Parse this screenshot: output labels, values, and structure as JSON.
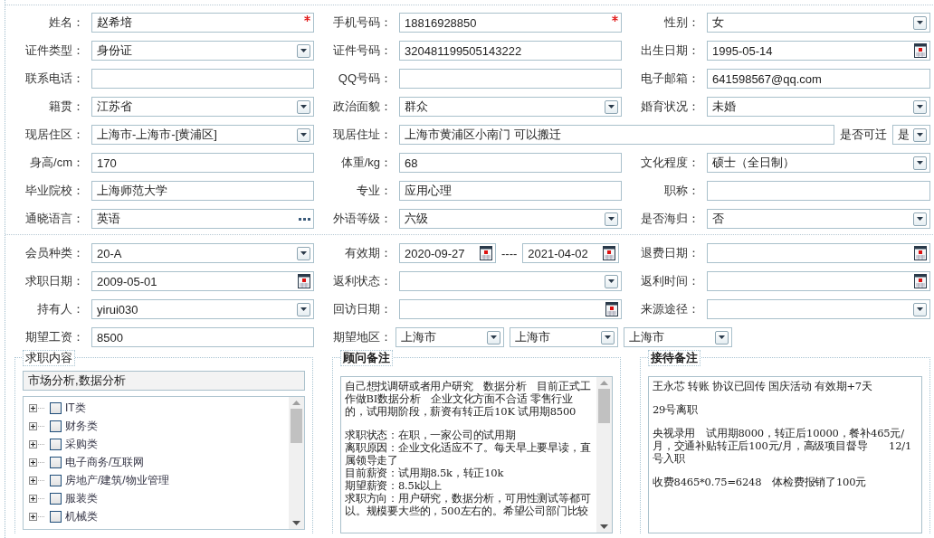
{
  "personal": {
    "rows": [
      {
        "fields": [
          {
            "label": "姓名：",
            "kind": "text",
            "value": "赵希培",
            "required": true
          },
          {
            "label": "手机号码：",
            "kind": "text",
            "value": "18816928850",
            "required": true
          },
          {
            "label": "性别：",
            "kind": "select",
            "value": "女"
          }
        ]
      },
      {
        "fields": [
          {
            "label": "证件类型：",
            "kind": "select",
            "value": "身份证"
          },
          {
            "label": "证件号码：",
            "kind": "text",
            "value": "320481199505143222"
          },
          {
            "label": "出生日期：",
            "kind": "date",
            "value": "1995-05-14"
          }
        ]
      },
      {
        "fields": [
          {
            "label": "联系电话：",
            "kind": "text"
          },
          {
            "label": "QQ号码：",
            "kind": "text"
          },
          {
            "label": "电子邮箱：",
            "kind": "text",
            "value": "641598567@qq.com"
          }
        ]
      },
      {
        "fields": [
          {
            "label": "籍贯：",
            "kind": "select",
            "value": "江苏省"
          },
          {
            "label": "政治面貌：",
            "kind": "select",
            "value": "群众"
          },
          {
            "label": "婚育状况：",
            "kind": "select",
            "value": "未婚"
          }
        ]
      },
      {
        "fields": [
          {
            "label": "现居住区：",
            "kind": "select",
            "value": "上海市-上海市-[黄浦区]"
          },
          {
            "label": "现居住址：",
            "kind": "wide_text",
            "value": "上海市黄浦区小南门  可以搬迁",
            "extra_label": "是否可迁",
            "extra_value": "是"
          }
        ]
      },
      {
        "fields": [
          {
            "label": "身高/cm：",
            "kind": "text",
            "value": "170"
          },
          {
            "label": "体重/kg：",
            "kind": "text",
            "value": "68"
          },
          {
            "label": "文化程度：",
            "kind": "select",
            "value": "硕士（全日制）"
          }
        ]
      },
      {
        "fields": [
          {
            "label": "毕业院校：",
            "kind": "text",
            "value": "上海师范大学"
          },
          {
            "label": "专业：",
            "kind": "text",
            "value": "应用心理"
          },
          {
            "label": "职称：",
            "kind": "text"
          }
        ]
      },
      {
        "fields": [
          {
            "label": "通晓语言：",
            "kind": "lookup",
            "value": "英语"
          },
          {
            "label": "外语等级：",
            "kind": "select",
            "value": "六级"
          },
          {
            "label": "是否海归：",
            "kind": "select",
            "value": "否"
          }
        ]
      }
    ]
  },
  "membership": {
    "rows": [
      {
        "fields": [
          {
            "label": "会员种类：",
            "kind": "select",
            "value": "20-A"
          },
          {
            "label": "有效期：",
            "kind": "date_range",
            "values": [
              "2020-09-27",
              "2021-04-02"
            ],
            "separator": "----"
          },
          {
            "label": "退费日期：",
            "kind": "date"
          }
        ]
      },
      {
        "fields": [
          {
            "label": "求职日期：",
            "kind": "date",
            "value": "2009-05-01"
          },
          {
            "label": "返利状态：",
            "kind": "select"
          },
          {
            "label": "返利时间：",
            "kind": "date"
          }
        ]
      },
      {
        "fields": [
          {
            "label": "持有人：",
            "kind": "select",
            "value": "yirui030"
          },
          {
            "label": "回访日期：",
            "kind": "date"
          },
          {
            "label": "来源途径：",
            "kind": "select"
          }
        ]
      },
      {
        "fields": [
          {
            "label": "期望工资：",
            "kind": "text",
            "value": "8500"
          },
          {
            "label": "期望地区：",
            "kind": "select_group",
            "values": [
              "上海市",
              "上海市",
              "上海市"
            ]
          }
        ]
      }
    ]
  },
  "job_content": {
    "title": "求职内容",
    "summary": "市场分析,数据分析",
    "items": [
      {
        "label": "IT类",
        "checked": false,
        "expanded": false
      },
      {
        "label": "财务类",
        "checked": false,
        "expanded": false
      },
      {
        "label": "采购类",
        "checked": false,
        "expanded": false
      },
      {
        "label": "电子商务/互联网",
        "checked": false,
        "expanded": false
      },
      {
        "label": "房地产/建筑/物业管理",
        "checked": false,
        "expanded": false
      },
      {
        "label": "服装类",
        "checked": false,
        "expanded": false
      },
      {
        "label": "机械类",
        "checked": false,
        "expanded": false
      }
    ]
  },
  "notes": [
    {
      "title": "顾问备注",
      "scrollable": true,
      "blocks": [
        {
          "lines": [
            "自己想找调研或者用户研究　数据分析　目前正式工作做BI数据分析　企业文化方面不合适 零售行业的，试用期阶段，薪资有转正后10K 试用期8500"
          ]
        },
        {
          "lines": [
            "求职状态：在职，一家公司的试用期",
            "离职原因：企业文化适应不了。每天早上要早读，直属领导走了",
            "目前薪资：试用期8.5k，转正10k",
            "期望薪资：8.5k以上",
            "求职方向：用户研究，数据分析，可用性测试等都可以。规模要大些的，500左右的。希望公司部门比较"
          ]
        }
      ]
    },
    {
      "title": "接待备注",
      "scrollable": false,
      "blocks": [
        {
          "lines": [
            "王永芯 转账 协议已回传 国庆活动 有效期+7天"
          ]
        },
        {
          "lines": [
            "29号离职"
          ]
        },
        {
          "lines": [
            "央视录用　试用期8000，转正后10000，餐补465元/月，交通补贴转正后100元/月，高级项目督导　　12/1号入职"
          ]
        },
        {
          "lines": [
            "收费8465*0.75=6248　体检费报销了100元"
          ]
        }
      ]
    }
  ]
}
